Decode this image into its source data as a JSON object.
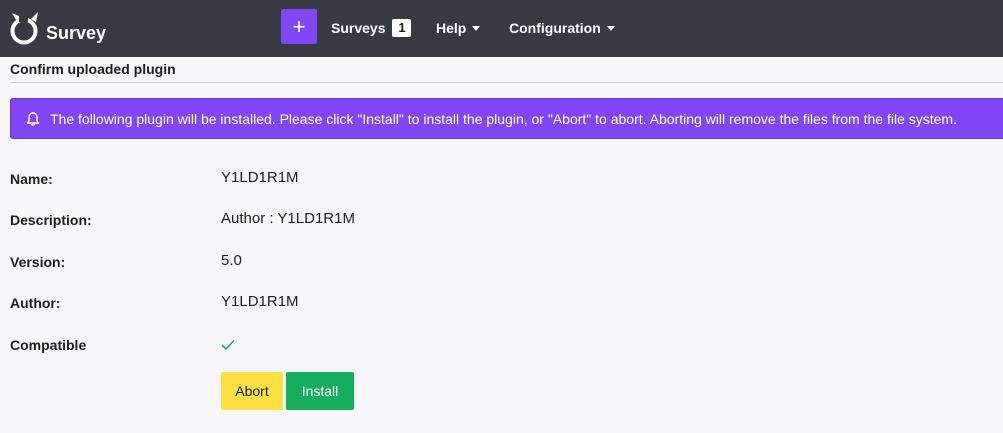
{
  "navbar": {
    "brand": "Survey",
    "add_label": "+",
    "surveys_label": "Surveys",
    "surveys_count": "1",
    "help_label": "Help",
    "config_label": "Configuration"
  },
  "page": {
    "title": "Confirm uploaded plugin"
  },
  "alert": {
    "icon": "bell-icon",
    "message": "The following plugin will be installed. Please click \"Install\" to install the plugin, or \"Abort\" to abort. Aborting will remove the files from the file system."
  },
  "details": {
    "name_label": "Name:",
    "name_value": "Y1LD1R1M",
    "description_label": "Description:",
    "description_value": "Author : Y1LD1R1M",
    "version_label": "Version:",
    "version_value": "5.0",
    "author_label": "Author:",
    "author_value": "Y1LD1R1M",
    "compatible_label": "Compatible",
    "compatible_icon": "check-icon"
  },
  "actions": {
    "abort_label": "Abort",
    "install_label": "Install"
  },
  "colors": {
    "navbar": "#373a42",
    "accent": "#8146f6",
    "abort": "#ffe045",
    "install": "#14ae5c",
    "check": "#14ae5c"
  }
}
